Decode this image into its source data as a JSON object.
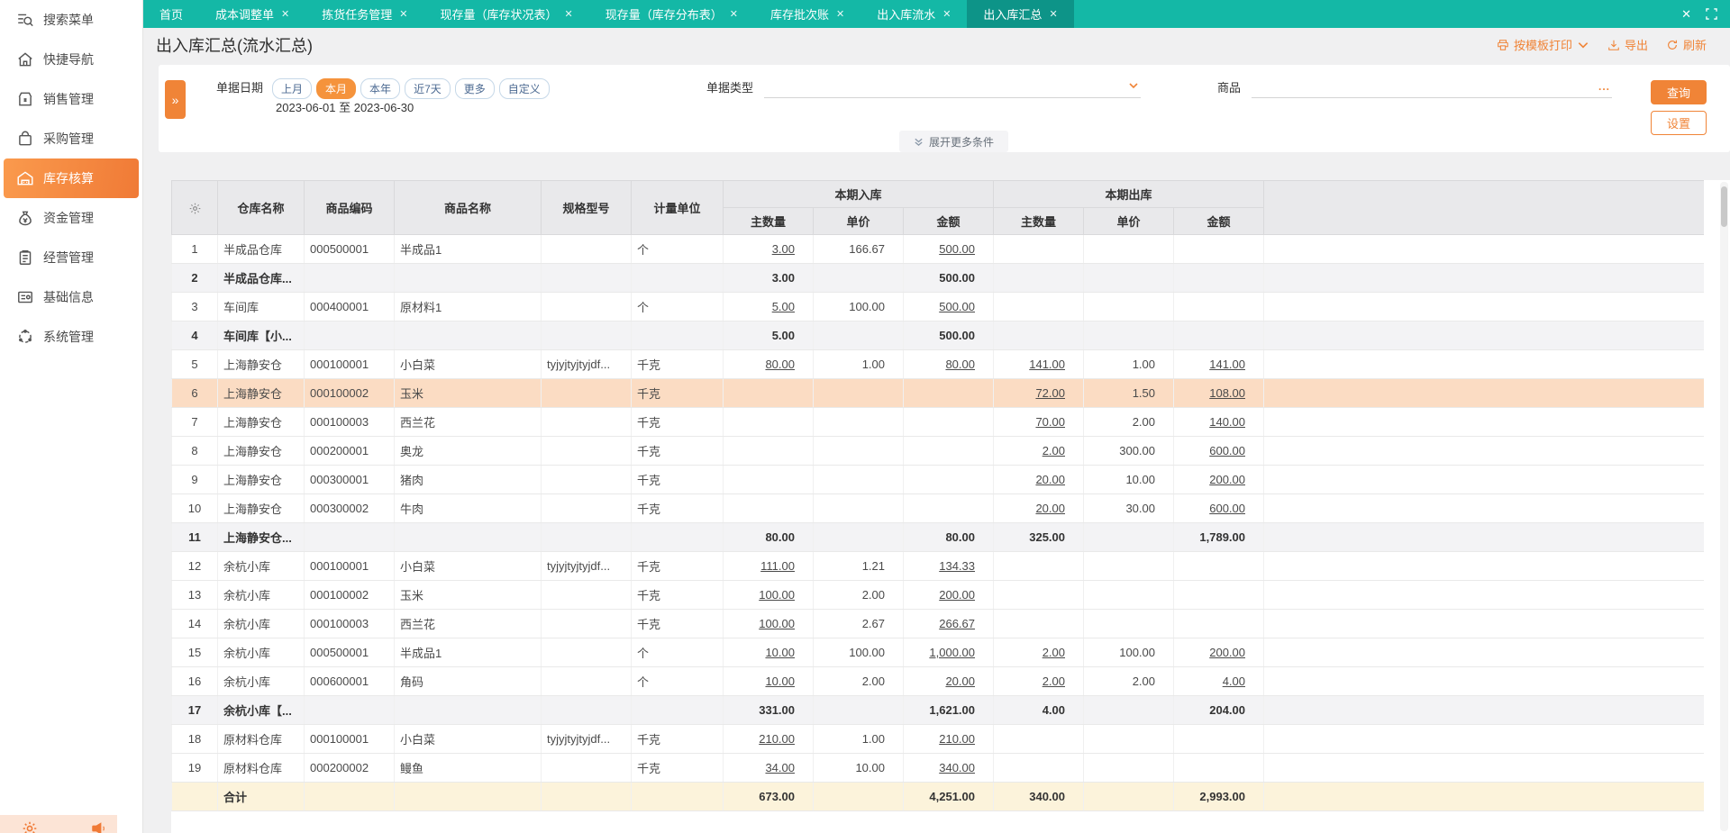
{
  "colors": {
    "accent_orange": "#f08437",
    "teal": "#14b8a6",
    "teal_active": "#0d9488",
    "row_highlight": "#fbdcc3",
    "total_row_bg": "#fcf3db"
  },
  "tabs": {
    "items": [
      {
        "key": "home",
        "label": "首页",
        "closable": false
      },
      {
        "key": "cost-adjust",
        "label": "成本调整单",
        "closable": true
      },
      {
        "key": "picking-task",
        "label": "拣货任务管理",
        "closable": true
      },
      {
        "key": "stock-status",
        "label": "现存量（库存状况表）",
        "closable": true
      },
      {
        "key": "stock-distribution",
        "label": "现存量（库存分布表）",
        "closable": true
      },
      {
        "key": "stock-batch",
        "label": "库存批次账",
        "closable": true
      },
      {
        "key": "inout-flow",
        "label": "出入库流水",
        "closable": true
      },
      {
        "key": "inout-summary",
        "label": "出入库汇总",
        "closable": true,
        "active": true
      }
    ]
  },
  "sidebar": {
    "items": [
      {
        "key": "search-menu",
        "label": "搜索菜单",
        "icon": "search-menu"
      },
      {
        "key": "quick-nav",
        "label": "快捷导航",
        "icon": "home"
      },
      {
        "key": "sales",
        "label": "销售管理",
        "icon": "shop"
      },
      {
        "key": "purchase",
        "label": "采购管理",
        "icon": "bag"
      },
      {
        "key": "inventory-accounting",
        "label": "库存核算",
        "icon": "warehouse",
        "active": true
      },
      {
        "key": "funds",
        "label": "资金管理",
        "icon": "money"
      },
      {
        "key": "operation",
        "label": "经营管理",
        "icon": "clipboard"
      },
      {
        "key": "base-info",
        "label": "基础信息",
        "icon": "idcard"
      },
      {
        "key": "system",
        "label": "系统管理",
        "icon": "system"
      }
    ]
  },
  "page": {
    "title": "出入库汇总(流水汇总)",
    "actions": {
      "print": "按模板打印",
      "export": "导出",
      "refresh": "刷新"
    }
  },
  "filters": {
    "date_label": "单据日期",
    "date_options": [
      "上月",
      "本月",
      "本年",
      "近7天",
      "更多",
      "自定义"
    ],
    "date_active": "本月",
    "date_range": "2023-06-01 至 2023-06-30",
    "doc_type_label": "单据类型",
    "product_label": "商品",
    "product_more": "...",
    "search_button": "查询",
    "settings_button": "设置",
    "expand_more": "展开更多条件"
  },
  "table": {
    "columns": [
      "仓库名称",
      "商品编码",
      "商品名称",
      "规格型号",
      "计量单位"
    ],
    "group_in": "本期入库",
    "group_out": "本期出库",
    "sub_columns": [
      "主数量",
      "单价",
      "金额"
    ],
    "rows": [
      {
        "no": "1",
        "warehouse": "半成品仓库",
        "code": "000500001",
        "name": "半成品1",
        "spec": "",
        "unit": "个",
        "iq": "3.00",
        "ip": "166.67",
        "ia": "500.00",
        "oq": "",
        "op": "",
        "oa": "",
        "type": "normal"
      },
      {
        "no": "2",
        "warehouse": "半成品仓库...",
        "code": "",
        "name": "",
        "spec": "",
        "unit": "",
        "iq": "3.00",
        "ip": "",
        "ia": "500.00",
        "oq": "",
        "op": "",
        "oa": "",
        "type": "subtotal"
      },
      {
        "no": "3",
        "warehouse": "车间库",
        "code": "000400001",
        "name": "原材料1",
        "spec": "",
        "unit": "个",
        "iq": "5.00",
        "ip": "100.00",
        "ia": "500.00",
        "oq": "",
        "op": "",
        "oa": "",
        "type": "normal"
      },
      {
        "no": "4",
        "warehouse": "车间库【小...",
        "code": "",
        "name": "",
        "spec": "",
        "unit": "",
        "iq": "5.00",
        "ip": "",
        "ia": "500.00",
        "oq": "",
        "op": "",
        "oa": "",
        "type": "subtotal"
      },
      {
        "no": "5",
        "warehouse": "上海静安仓",
        "code": "000100001",
        "name": "小白菜",
        "spec": "tyjyjtyjtyjdf...",
        "unit": "千克",
        "iq": "80.00",
        "ip": "1.00",
        "ia": "80.00",
        "oq": "141.00",
        "op": "1.00",
        "oa": "141.00",
        "type": "normal"
      },
      {
        "no": "6",
        "warehouse": "上海静安仓",
        "code": "000100002",
        "name": "玉米",
        "spec": "",
        "unit": "千克",
        "iq": "",
        "ip": "",
        "ia": "",
        "oq": "72.00",
        "op": "1.50",
        "oa": "108.00",
        "type": "normal",
        "highlight": true
      },
      {
        "no": "7",
        "warehouse": "上海静安仓",
        "code": "000100003",
        "name": "西兰花",
        "spec": "",
        "unit": "千克",
        "iq": "",
        "ip": "",
        "ia": "",
        "oq": "70.00",
        "op": "2.00",
        "oa": "140.00",
        "type": "normal"
      },
      {
        "no": "8",
        "warehouse": "上海静安仓",
        "code": "000200001",
        "name": "奥龙",
        "spec": "",
        "unit": "千克",
        "iq": "",
        "ip": "",
        "ia": "",
        "oq": "2.00",
        "op": "300.00",
        "oa": "600.00",
        "type": "normal"
      },
      {
        "no": "9",
        "warehouse": "上海静安仓",
        "code": "000300001",
        "name": "猪肉",
        "spec": "",
        "unit": "千克",
        "iq": "",
        "ip": "",
        "ia": "",
        "oq": "20.00",
        "op": "10.00",
        "oa": "200.00",
        "type": "normal"
      },
      {
        "no": "10",
        "warehouse": "上海静安仓",
        "code": "000300002",
        "name": "牛肉",
        "spec": "",
        "unit": "千克",
        "iq": "",
        "ip": "",
        "ia": "",
        "oq": "20.00",
        "op": "30.00",
        "oa": "600.00",
        "type": "normal"
      },
      {
        "no": "11",
        "warehouse": "上海静安仓...",
        "code": "",
        "name": "",
        "spec": "",
        "unit": "",
        "iq": "80.00",
        "ip": "",
        "ia": "80.00",
        "oq": "325.00",
        "op": "",
        "oa": "1,789.00",
        "type": "subtotal"
      },
      {
        "no": "12",
        "warehouse": "余杭小库",
        "code": "000100001",
        "name": "小白菜",
        "spec": "tyjyjtyjtyjdf...",
        "unit": "千克",
        "iq": "111.00",
        "ip": "1.21",
        "ia": "134.33",
        "oq": "",
        "op": "",
        "oa": "",
        "type": "normal"
      },
      {
        "no": "13",
        "warehouse": "余杭小库",
        "code": "000100002",
        "name": "玉米",
        "spec": "",
        "unit": "千克",
        "iq": "100.00",
        "ip": "2.00",
        "ia": "200.00",
        "oq": "",
        "op": "",
        "oa": "",
        "type": "normal"
      },
      {
        "no": "14",
        "warehouse": "余杭小库",
        "code": "000100003",
        "name": "西兰花",
        "spec": "",
        "unit": "千克",
        "iq": "100.00",
        "ip": "2.67",
        "ia": "266.67",
        "oq": "",
        "op": "",
        "oa": "",
        "type": "normal"
      },
      {
        "no": "15",
        "warehouse": "余杭小库",
        "code": "000500001",
        "name": "半成品1",
        "spec": "",
        "unit": "个",
        "iq": "10.00",
        "ip": "100.00",
        "ia": "1,000.00",
        "oq": "2.00",
        "op": "100.00",
        "oa": "200.00",
        "type": "normal"
      },
      {
        "no": "16",
        "warehouse": "余杭小库",
        "code": "000600001",
        "name": "角码",
        "spec": "",
        "unit": "个",
        "iq": "10.00",
        "ip": "2.00",
        "ia": "20.00",
        "oq": "2.00",
        "op": "2.00",
        "oa": "4.00",
        "type": "normal"
      },
      {
        "no": "17",
        "warehouse": "余杭小库【...",
        "code": "",
        "name": "",
        "spec": "",
        "unit": "",
        "iq": "331.00",
        "ip": "",
        "ia": "1,621.00",
        "oq": "4.00",
        "op": "",
        "oa": "204.00",
        "type": "subtotal"
      },
      {
        "no": "18",
        "warehouse": "原材料仓库",
        "code": "000100001",
        "name": "小白菜",
        "spec": "tyjyjtyjtyjdf...",
        "unit": "千克",
        "iq": "210.00",
        "ip": "1.00",
        "ia": "210.00",
        "oq": "",
        "op": "",
        "oa": "",
        "type": "normal"
      },
      {
        "no": "19",
        "warehouse": "原材料仓库",
        "code": "000200002",
        "name": "鳗鱼",
        "spec": "",
        "unit": "千克",
        "iq": "34.00",
        "ip": "10.00",
        "ia": "340.00",
        "oq": "",
        "op": "",
        "oa": "",
        "type": "normal"
      }
    ],
    "total_row": {
      "no": "",
      "warehouse": "合计",
      "code": "",
      "name": "",
      "spec": "",
      "unit": "",
      "iq": "673.00",
      "ip": "",
      "ia": "4,251.00",
      "oq": "340.00",
      "op": "",
      "oa": "2,993.00",
      "type": "total"
    }
  }
}
